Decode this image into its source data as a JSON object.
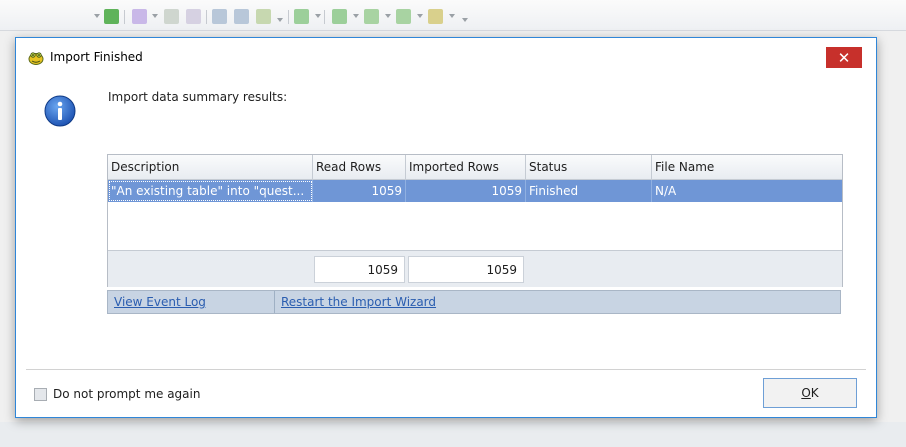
{
  "dialog": {
    "title": "Import Finished",
    "close_label": "✕",
    "summary_heading": "Import data summary results:"
  },
  "grid": {
    "columns": [
      "Description",
      "Read Rows",
      "Imported Rows",
      "Status",
      "File Name"
    ],
    "rows": [
      {
        "description": "\"An existing table\" into \"quest...",
        "read_rows": "1059",
        "imported_rows": "1059",
        "status": "Finished",
        "file_name": "N/A"
      }
    ],
    "totals": {
      "read_rows": "1059",
      "imported_rows": "1059"
    }
  },
  "links": {
    "view_event_log": "View Event Log",
    "restart_wizard": "Restart the Import Wizard"
  },
  "footer": {
    "checkbox_label": "Do not prompt me again",
    "checkbox_checked": false,
    "ok_label_accel": "O",
    "ok_label_rest": "K"
  },
  "colors": {
    "close_button": "#c7302b",
    "selected_row": "#6f96d6",
    "dialog_border": "#2f86d8",
    "link": "#2a5db0"
  },
  "icons": {
    "title": "toad-app-icon",
    "info": "information-icon",
    "close": "close-icon"
  }
}
